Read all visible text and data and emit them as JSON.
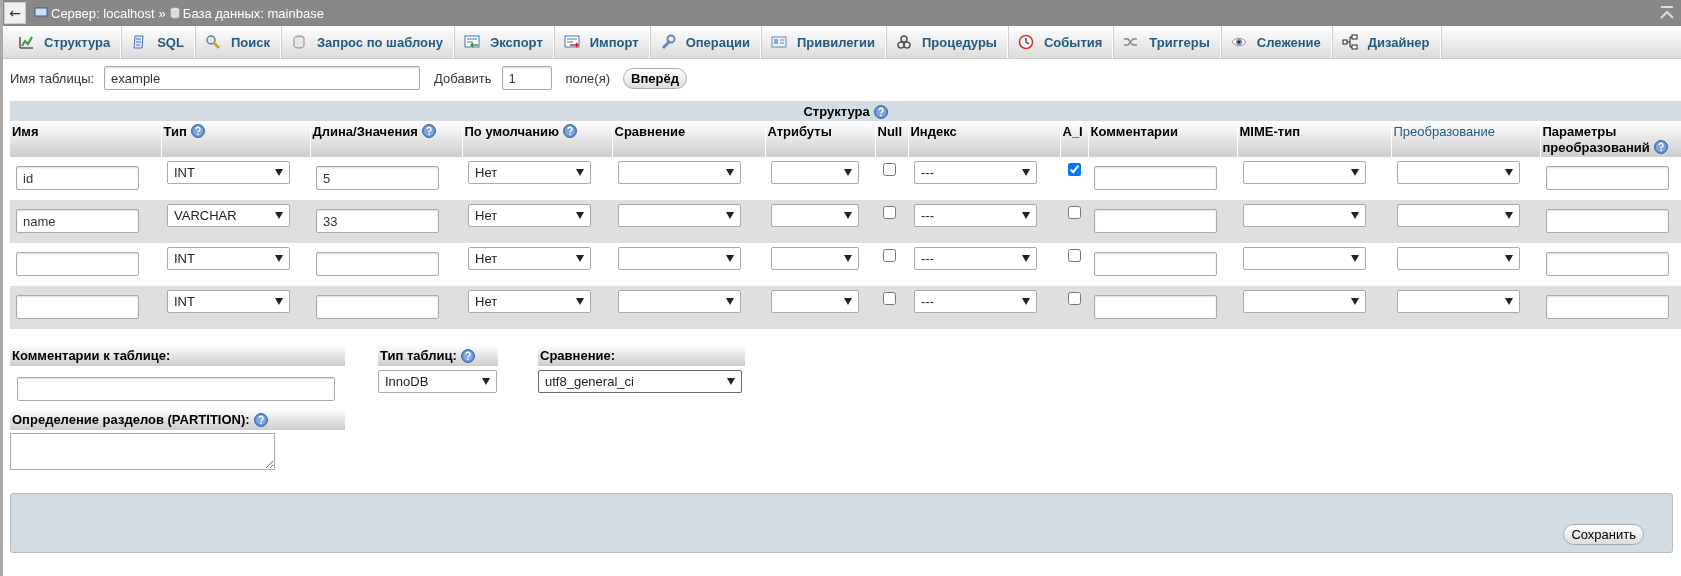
{
  "breadcrumb": {
    "back": "←",
    "items": [
      {
        "kind": "server",
        "text": "Сервер: localhost"
      },
      {
        "kind": "database",
        "text": "База данных: mainbase"
      }
    ],
    "separator": "»"
  },
  "tabs": [
    {
      "label": "Структура",
      "selected": false
    },
    {
      "label": "SQL",
      "selected": false
    },
    {
      "label": "Поиск",
      "selected": false
    },
    {
      "label": "Запрос по шаблону",
      "selected": false
    },
    {
      "label": "Экспорт",
      "selected": false
    },
    {
      "label": "Импорт",
      "selected": false
    },
    {
      "label": "Операции",
      "selected": false
    },
    {
      "label": "Привилегии",
      "selected": false
    },
    {
      "label": "Процедуры",
      "selected": false
    },
    {
      "label": "События",
      "selected": false
    },
    {
      "label": "Триггеры",
      "selected": false
    },
    {
      "label": "Слежение",
      "selected": false
    },
    {
      "label": "Дизайнер",
      "selected": false
    }
  ],
  "table_name": {
    "label": "Имя таблицы:",
    "value": "example"
  },
  "add_fields": {
    "label": "Добавить",
    "value": "1",
    "suffix": "поле(я)",
    "button": "Вперёд"
  },
  "structure": {
    "caption": "Структура",
    "caption_help": true,
    "columns": [
      {
        "label": "Имя",
        "kind": "text",
        "help": false,
        "link": false
      },
      {
        "label": "Тип",
        "kind": "select",
        "help": true,
        "link": false
      },
      {
        "label": "Длина/Значения",
        "kind": "text",
        "help": true,
        "link": false
      },
      {
        "label": "По умолчанию",
        "kind": "select",
        "help": true,
        "link": false
      },
      {
        "label": "Сравнение",
        "kind": "select",
        "help": false,
        "link": false
      },
      {
        "label": "Атрибуты",
        "kind": "select",
        "help": false,
        "link": false
      },
      {
        "label": "Null",
        "kind": "checkbox",
        "help": false,
        "link": false
      },
      {
        "label": "Индекс",
        "kind": "select",
        "help": false,
        "link": false
      },
      {
        "label": "A_I",
        "kind": "checkbox",
        "help": false,
        "link": false
      },
      {
        "label": "Комментарии",
        "kind": "text",
        "help": false,
        "link": false
      },
      {
        "label": "MIME-тип",
        "kind": "select",
        "help": false,
        "link": false
      },
      {
        "label": "Преобразование",
        "kind": "select",
        "help": false,
        "link": true
      },
      {
        "label": "Параметры преобразований",
        "kind": "text",
        "help": true,
        "link": false
      }
    ],
    "rows": [
      {
        "cells": [
          {
            "value": "id"
          },
          {
            "value": "INT"
          },
          {
            "value": "5"
          },
          {
            "value": "Нет"
          },
          {},
          {},
          {
            "checked": false
          },
          {
            "value": "---"
          },
          {
            "checked": true
          },
          {},
          {},
          {},
          {}
        ]
      },
      {
        "cells": [
          {
            "value": "name"
          },
          {
            "value": "VARCHAR"
          },
          {
            "value": "33"
          },
          {
            "value": "Нет"
          },
          {},
          {},
          {
            "checked": false
          },
          {
            "value": "---"
          },
          {
            "checked": false
          },
          {},
          {},
          {},
          {}
        ]
      },
      {
        "cells": [
          {},
          {
            "value": "INT"
          },
          {},
          {
            "value": "Нет"
          },
          {},
          {},
          {
            "checked": false
          },
          {
            "value": "---"
          },
          {
            "checked": false
          },
          {},
          {},
          {},
          {}
        ]
      },
      {
        "cells": [
          {},
          {
            "value": "INT"
          },
          {},
          {
            "value": "Нет"
          },
          {},
          {},
          {
            "checked": false
          },
          {
            "value": "---"
          },
          {
            "checked": false
          },
          {},
          {},
          {},
          {}
        ]
      }
    ]
  },
  "table_comment": {
    "label": "Комментарии к таблице:"
  },
  "partition": {
    "label": "Определение разделов (PARTITION):",
    "help": true
  },
  "engine": {
    "label": "Тип таблиц:",
    "help": true,
    "value": "InnoDB"
  },
  "collation": {
    "label": "Сравнение:",
    "value": "utf8_general_ci"
  },
  "save_button": "Сохранить"
}
